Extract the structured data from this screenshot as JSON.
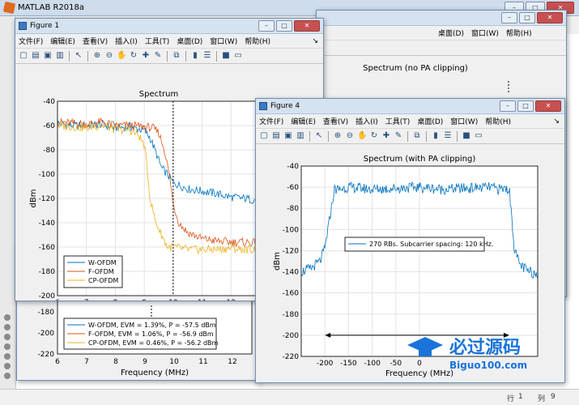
{
  "app": {
    "title": "MATLAB R2018a"
  },
  "status": {
    "row_label": "行",
    "row": "1",
    "col_label": "列",
    "col": "9"
  },
  "menus": [
    "文件(F)",
    "编辑(E)",
    "查看(V)",
    "插入(I)",
    "工具(T)",
    "桌面(D)",
    "窗口(W)",
    "帮助(H)"
  ],
  "window_buttons": {
    "minimize": "–",
    "maximize": "□",
    "close": "✕"
  },
  "figures": {
    "fig1": {
      "title": "Figure 1"
    },
    "fig4": {
      "title": "Figure 4"
    }
  },
  "watermark": {
    "text": "必过源码",
    "url": "Biguo100.com"
  },
  "chart_data": [
    {
      "id": "fig1-spectrum",
      "type": "line",
      "title": "Spectrum",
      "xlabel": "Frequency (MHz)",
      "ylabel": "dBm",
      "xlim": [
        6,
        13
      ],
      "ylim": [
        -200,
        -40
      ],
      "xticks": [
        6,
        7,
        8,
        9,
        10,
        11,
        12
      ],
      "yticks": [
        -200,
        -180,
        -160,
        -140,
        -120,
        -100,
        -80,
        -60,
        -40
      ],
      "grid": true,
      "vline": 10,
      "legend_position": "bottom-left",
      "series": [
        {
          "name": "W-OFDM",
          "color": "#0072bd",
          "x": [
            6,
            6.5,
            7,
            7.5,
            8,
            8.5,
            9,
            9.2,
            9.4,
            9.6,
            9.8,
            10,
            10.5,
            11,
            11.5,
            12,
            12.5,
            13
          ],
          "y": [
            -58,
            -60,
            -60,
            -59,
            -62,
            -61,
            -64,
            -70,
            -82,
            -95,
            -100,
            -107,
            -112,
            -114,
            -116,
            -119,
            -120,
            -122
          ]
        },
        {
          "name": "F-OFDM",
          "color": "#d95319",
          "x": [
            6,
            6.5,
            7,
            7.5,
            8,
            8.5,
            9,
            9.3,
            9.5,
            9.7,
            9.9,
            10,
            10.2,
            10.5,
            11,
            11.5,
            12,
            12.5,
            13
          ],
          "y": [
            -57,
            -58,
            -59,
            -57,
            -60,
            -60,
            -61,
            -62,
            -66,
            -80,
            -105,
            -125,
            -140,
            -148,
            -153,
            -155,
            -156,
            -156,
            -157
          ]
        },
        {
          "name": "CP-OFDM",
          "color": "#edb120",
          "x": [
            6,
            6.5,
            7,
            7.5,
            8,
            8.5,
            8.8,
            9,
            9.1,
            9.2,
            9.4,
            9.6,
            9.8,
            10,
            10.5,
            11,
            11.5,
            12,
            12.5,
            13
          ],
          "y": [
            -60,
            -61,
            -62,
            -60,
            -63,
            -64,
            -68,
            -76,
            -95,
            -120,
            -140,
            -150,
            -160,
            -160,
            -162,
            -162,
            -162,
            -161,
            -162,
            -162
          ]
        }
      ]
    },
    {
      "id": "fig4-spectrum-pa",
      "type": "line",
      "title": "Spectrum (with PA clipping)",
      "xlabel": "Frequency (MHz)",
      "ylabel": "dBm",
      "xlim": [
        -250,
        250
      ],
      "ylim": [
        -220,
        -40
      ],
      "xticks": [
        -200,
        -150,
        -100,
        -50,
        0
      ],
      "yticks": [
        -220,
        -200,
        -180,
        -160,
        -140,
        -120,
        -100,
        -80,
        -60,
        -40
      ],
      "grid": true,
      "legend_position": "center",
      "annotation": {
        "type": "double-arrow",
        "x": [
          -200,
          190
        ],
        "y": -200
      },
      "series": [
        {
          "name": "270 RBs. Subcarrier spacing: 120 kHz.",
          "color": "#0072bd",
          "x": [
            -250,
            -230,
            -210,
            -200,
            -190,
            -180,
            -170,
            -150,
            -100,
            -50,
            0,
            50,
            100,
            150,
            170,
            180,
            190,
            200,
            210,
            230,
            250
          ],
          "y": [
            -140,
            -137,
            -130,
            -118,
            -90,
            -62,
            -62,
            -60,
            -62,
            -61,
            -60,
            -62,
            -61,
            -60,
            -62,
            -61,
            -62,
            -115,
            -132,
            -140,
            -142
          ]
        }
      ]
    }
  ],
  "bg_axes": {
    "rt_title": "Spectrum (no PA clipping)",
    "bl_ticks": [
      "-180",
      "-200",
      "-220"
    ],
    "bl_xticks": [
      "6",
      "7",
      "8",
      "9",
      "10",
      "11",
      "12"
    ],
    "bl_xlabel": "Frequency (MHz)",
    "bl_legend": [
      {
        "label": "W-OFDM, EVM = 1.39%, P = -57.5 dBm",
        "color": "#0072bd"
      },
      {
        "label": "F-OFDM, EVM = 1.06%, P = -56.9 dBm",
        "color": "#d95319"
      },
      {
        "label": "CP-OFDM, EVM = 0.46%, P = -56.2 dBm",
        "color": "#edb120"
      }
    ]
  }
}
